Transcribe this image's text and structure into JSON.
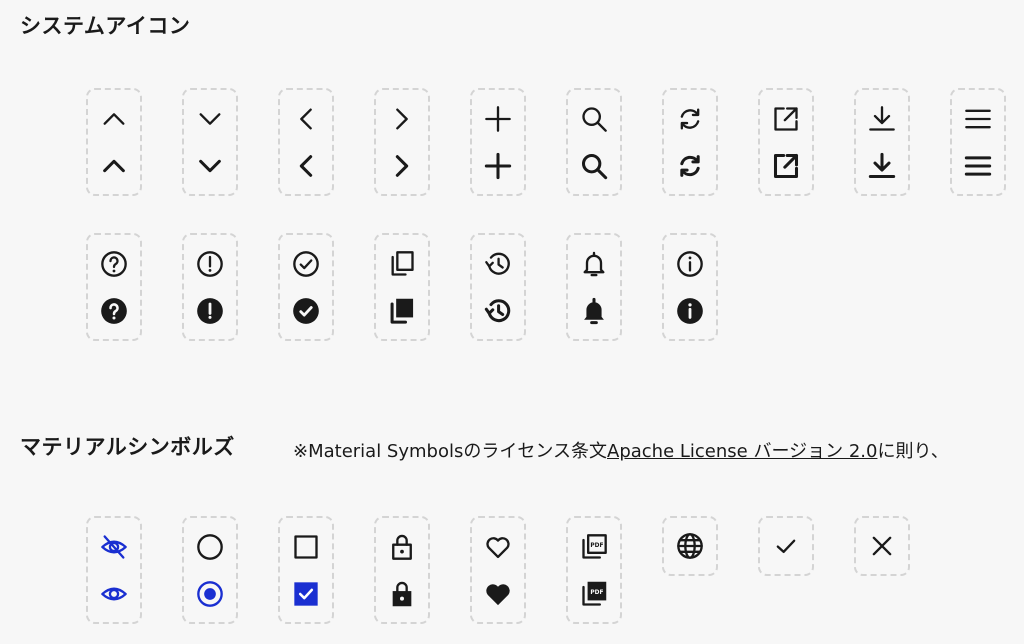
{
  "sections": {
    "system_icons_title": "システムアイコン",
    "material_symbols_title": "マテリアルシンボルズ",
    "material_note_prefix": "※Material Symbolsのライセンス条文",
    "material_note_link": "Apache License バージョン 2.0",
    "material_note_suffix": "に則り、"
  },
  "system_icons_row1": [
    "chevron-up",
    "chevron-down",
    "chevron-left",
    "chevron-right",
    "plus",
    "search",
    "refresh",
    "external-link",
    "download",
    "menu"
  ],
  "system_icons_row2": [
    "help",
    "alert",
    "check-circle",
    "copy",
    "history",
    "bell",
    "info"
  ],
  "material_symbols_row": [
    "visibility",
    "radio-button",
    "checkbox",
    "lock",
    "favorite",
    "picture-as-pdf",
    "language",
    "check",
    "close"
  ],
  "colors": {
    "accent": "#1a2fd1",
    "border": "#d4d4d4",
    "background": "#f7f7f7"
  }
}
